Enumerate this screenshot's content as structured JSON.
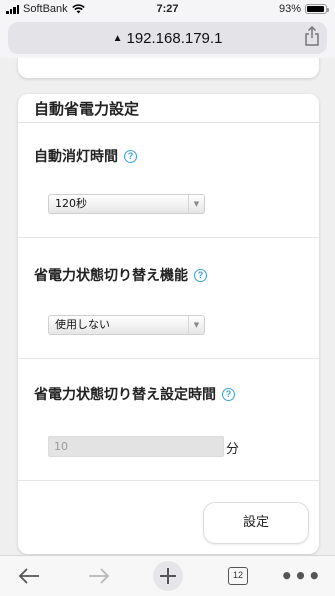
{
  "status_bar": {
    "carrier": "SoftBank",
    "time": "7:27",
    "battery": "93%",
    "battery_level": 0.93
  },
  "url_bar": {
    "url": "192.168.179.1"
  },
  "card": {
    "title": "自動省電力設定",
    "auto_off": {
      "label": "自動消灯時間",
      "selected": "120秒"
    },
    "power_save": {
      "label": "省電力状態切り替え機能",
      "selected": "使用しない"
    },
    "switch_time": {
      "label": "省電力状態切り替え設定時間",
      "placeholder": "10",
      "unit": "分"
    },
    "submit_label": "設定"
  },
  "toolbar": {
    "tabs_count": "12"
  },
  "colors": {
    "help_icon": "#3aa0d8",
    "page_bg": "#efefef"
  }
}
